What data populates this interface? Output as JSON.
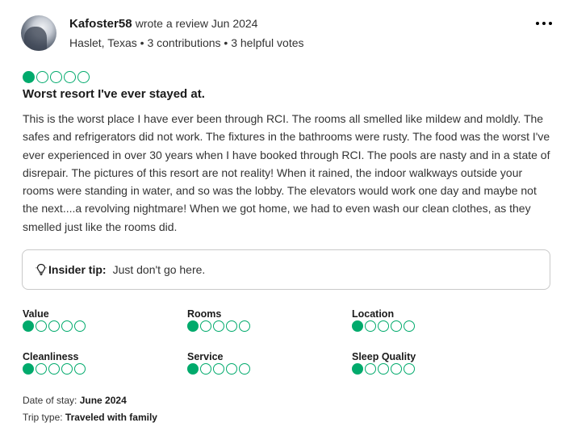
{
  "reviewer": {
    "username": "Kafoster58",
    "wrote_text": "wrote a review Jun 2024",
    "location": "Haslet, Texas",
    "contributions": "3 contributions",
    "helpful_votes": "3 helpful votes",
    "separator": "•"
  },
  "menu": {
    "icon": "more-horizontal-icon"
  },
  "review": {
    "rating": 1,
    "max_rating": 5,
    "title": "Worst resort I've ever stayed at.",
    "body": "This is the worst place I have ever been through RCI. The rooms all smelled like mildew and moldly. The safes and refrigerators did not work. The fixtures in the bathrooms were rusty. The food was the worst I've ever experienced in over 30 years when I have booked through RCI. The pools are nasty and in a state of disrepair. The pictures of this resort are not reality! When it rained, the indoor walkways outside your rooms were standing in water, and so was the lobby. The elevators would work one day and maybe not the next....a revolving nightmare! When we got home, we had to even wash our clean clothes, as they smelled just like the rooms did."
  },
  "insider_tip": {
    "icon": "lightbulb-icon",
    "label": "Insider tip:",
    "text": "Just don't go here."
  },
  "sub_ratings": [
    {
      "label": "Value",
      "rating": 1
    },
    {
      "label": "Rooms",
      "rating": 1
    },
    {
      "label": "Location",
      "rating": 1
    },
    {
      "label": "Cleanliness",
      "rating": 1
    },
    {
      "label": "Service",
      "rating": 1
    },
    {
      "label": "Sleep Quality",
      "rating": 1
    }
  ],
  "stay": {
    "date_label": "Date of stay:",
    "date_value": "June 2024",
    "trip_label": "Trip type:",
    "trip_value": "Traveled with family"
  },
  "colors": {
    "bubble_green": "#00aa6c",
    "text_dark": "#1a1a1a",
    "text_body": "#333333",
    "tip_border": "#c9c9c9"
  }
}
